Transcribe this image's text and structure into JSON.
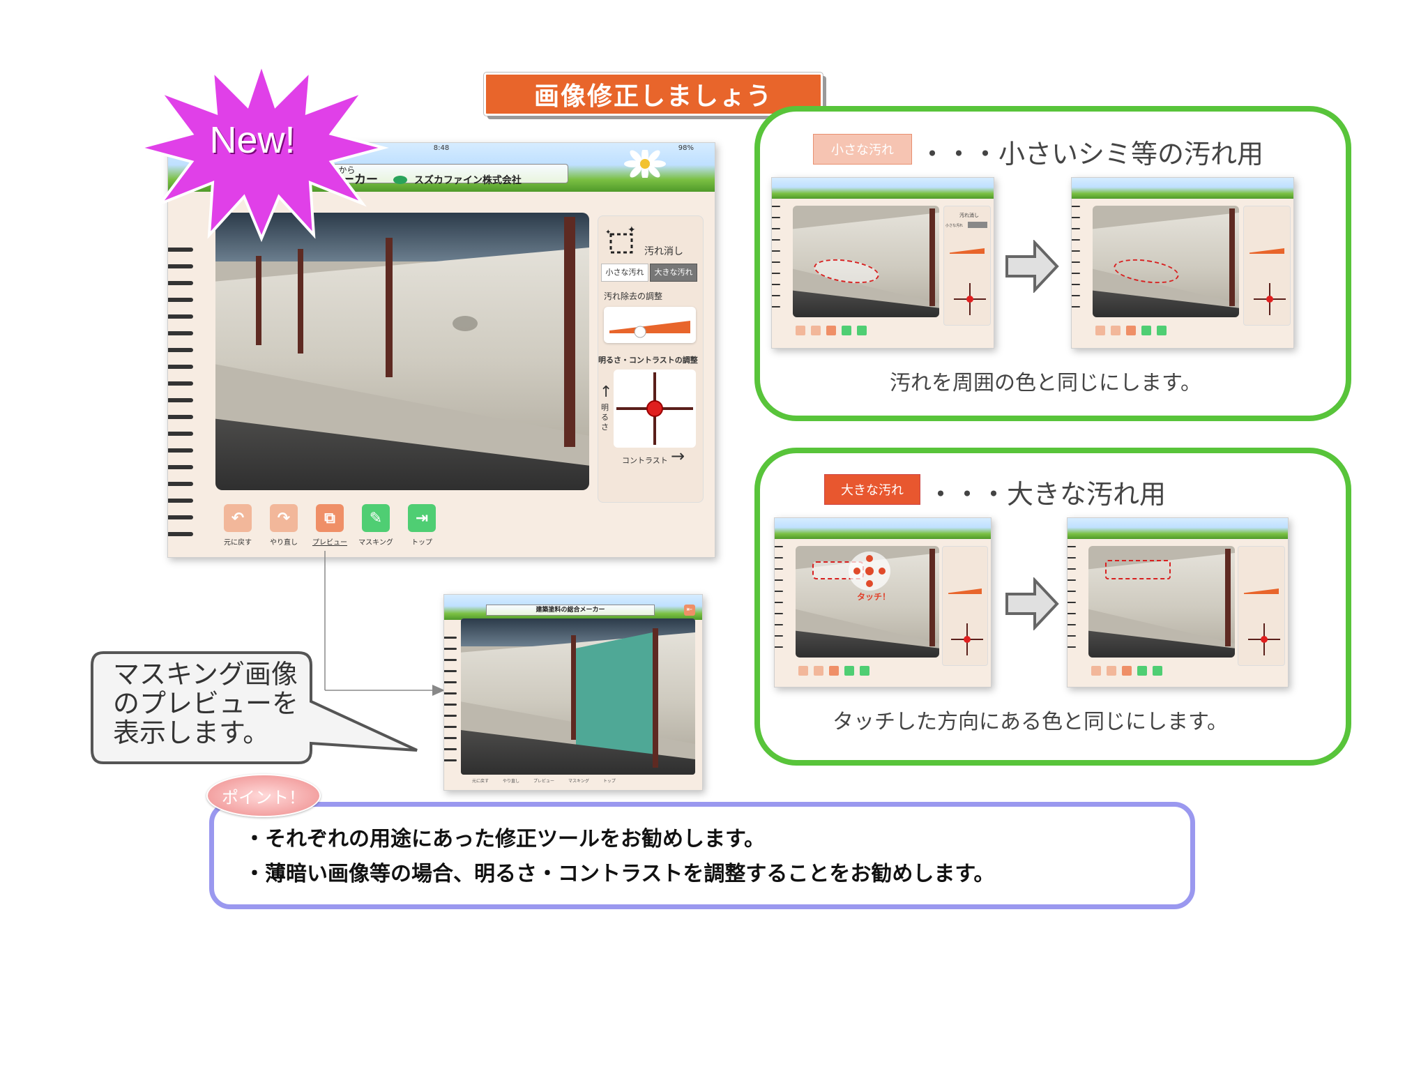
{
  "title": "画像修正しましょう",
  "new_badge": "New!",
  "main_ipad": {
    "status_time": "8:48",
    "status_battery": "98%",
    "header_left": "きんでほしいから",
    "header_mid": "メーカー",
    "header_brand": "スズカファイン株式会社",
    "stain_label": "汚れ消し",
    "small_stain_btn": "小さな汚れ",
    "large_stain_btn": "大きな汚れ",
    "removal_adjust_label": "汚れ除去の調整",
    "removal_level": 0.38,
    "brightness_contrast_label": "明るさ・コントラストの調整",
    "brightness_axis": "明るさ",
    "contrast_axis": "コントラスト",
    "toolbar": [
      {
        "label": "元に戻す",
        "color": "#f2b79a",
        "icon": "undo-icon",
        "glyph": "↶"
      },
      {
        "label": "やり直し",
        "color": "#f2b79a",
        "icon": "redo-icon",
        "glyph": "↷"
      },
      {
        "label": "プレビュー",
        "color": "#ef8f67",
        "icon": "preview-icon",
        "glyph": "⧉"
      },
      {
        "label": "マスキング",
        "color": "#4fce73",
        "icon": "masking-icon",
        "glyph": "✎"
      },
      {
        "label": "トップ",
        "color": "#4fce73",
        "icon": "top-icon",
        "glyph": "⇥"
      }
    ]
  },
  "preview_ipad": {
    "header_brand": "建築塗料の総合メーカー",
    "toolbar": [
      "元に戻す",
      "やり直し",
      "プレビュー",
      "マスキング",
      "トップ"
    ]
  },
  "bubble_text": [
    "マスキング画像",
    "のプレビューを",
    "表示します。"
  ],
  "small_box": {
    "tag": "小さな汚れ",
    "heading": "・・・小さいシミ等の汚れ用",
    "caption": "汚れを周囲の色と同じにします。",
    "mini_stain_label": "汚れ消し",
    "mini_small_btn": "小さな汚れ",
    "mini_large_btn": "大きな汚れ"
  },
  "large_box": {
    "tag": "大きな汚れ",
    "heading": "・・・大きな汚れ用",
    "caption": "タッチした方向にある色と同じにします。",
    "touch_label": "タッチ！"
  },
  "point": {
    "badge": "ポイント！",
    "lines": [
      "・それぞれの用途にあった修正ツールをお勧めします。",
      "・薄暗い画像等の場合、明るさ・コントラストを調整することをお勧めします。"
    ]
  },
  "colors": {
    "banner": "#e8652b",
    "green_frame": "#58c43a",
    "point_frame": "#9a98ef",
    "burst": "#e040e8",
    "small_tag": "#f6c4b2",
    "large_tag": "#e8572f"
  }
}
